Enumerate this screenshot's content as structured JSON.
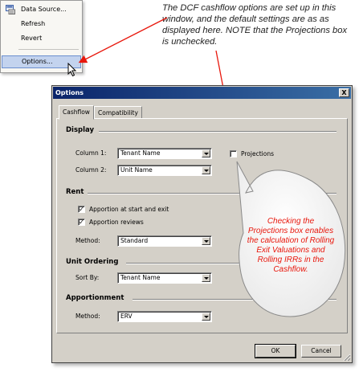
{
  "context_menu": {
    "items": [
      {
        "label": "Data Source...",
        "icon": "data-source-icon"
      },
      {
        "label": "Refresh"
      },
      {
        "label": "Revert"
      },
      {
        "label": "Options...",
        "selected": true
      }
    ]
  },
  "annotation": {
    "text": "The DCF cashflow options are set up in this window, and the default settings are as as displayed here. NOTE that the Projections box is unchecked."
  },
  "dialog": {
    "title": "Options",
    "close_label": "X",
    "tabs": [
      {
        "label": "Cashflow",
        "active": true
      },
      {
        "label": "Compatibility",
        "active": false
      }
    ],
    "display": {
      "title": "Display",
      "column1_label": "Column 1:",
      "column1_value": "Tenant Name",
      "column2_label": "Column 2:",
      "column2_value": "Unit Name",
      "projections_label": "Projections",
      "projections_checked": false
    },
    "rent": {
      "title": "Rent",
      "apportion_start_exit_label": "Apportion at start and exit",
      "apportion_start_exit_checked": true,
      "apportion_reviews_label": "Apportion reviews",
      "apportion_reviews_checked": true,
      "method_label": "Method:",
      "method_value": "Standard"
    },
    "unit_ordering": {
      "title": "Unit Ordering",
      "sort_by_label": "Sort By:",
      "sort_by_value": "Tenant Name"
    },
    "apportionment": {
      "title": "Apportionment",
      "method_label": "Method:",
      "method_value": "ERV"
    },
    "ok_label": "OK",
    "cancel_label": "Cancel",
    "check_mark": "✓"
  },
  "callout": {
    "text": "Checking the Projections box enables the calculation of Rolling Exit Valuations and Rolling IRRs in the Cashflow.",
    "color": "#e8170c"
  },
  "colors": {
    "dialog_face": "#d4d0c8",
    "titlebar_start": "#0a246a",
    "titlebar_end": "#3a6ea5",
    "menu_highlight": "#c3d3ee"
  }
}
